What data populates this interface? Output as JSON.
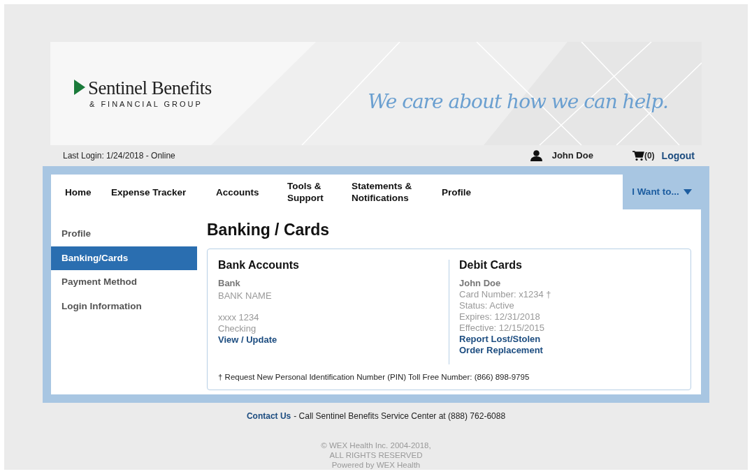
{
  "header": {
    "logo_title": "Sentinel Benefits",
    "logo_subtitle": "& FINANCIAL GROUP",
    "tagline": "We care about how we can help."
  },
  "user_bar": {
    "last_login": "Last Login: 1/24/2018 - Online",
    "user_name": "John Doe",
    "cart_count": "(0)",
    "logout": "Logout"
  },
  "nav": {
    "items": [
      {
        "label": "Home"
      },
      {
        "label": "Expense Tracker"
      },
      {
        "label": "Accounts"
      },
      {
        "label": "Tools & Support"
      },
      {
        "label": "Statements & Notifications"
      },
      {
        "label": "Profile"
      }
    ],
    "menu": "I Want to..."
  },
  "sidebar": {
    "items": [
      {
        "label": "Profile",
        "selected": false
      },
      {
        "label": "Banking/Cards",
        "selected": true
      },
      {
        "label": "Payment Method",
        "selected": false
      },
      {
        "label": "Login Information",
        "selected": false
      }
    ]
  },
  "page_title": "Banking / Cards",
  "bank_accounts": {
    "heading": "Bank Accounts",
    "label": "Bank",
    "bank_name": "BANK NAME",
    "account_number": "xxxx 1234",
    "account_type": "Checking",
    "link": "View / Update"
  },
  "debit_cards": {
    "heading": "Debit Cards",
    "holder": "John Doe",
    "details": [
      "Card Number: x1234 †",
      "Status: Active",
      "Expires: 12/31/2018",
      "Effective: 12/15/2015"
    ],
    "links": [
      "Report Lost/Stolen",
      "Order Replacement"
    ]
  },
  "pin_note": "† Request New Personal Identification Number (PIN) Toll Free Number: (866) 898-9795",
  "footer": {
    "contact_link": "Contact Us",
    "contact_text": "- Call Sentinel Benefits Service Center at (888) 762-6088",
    "copyright": [
      "© WEX Health Inc. 2004-2018,",
      "ALL RIGHTS RESERVED",
      "Powered by WEX Health"
    ]
  }
}
